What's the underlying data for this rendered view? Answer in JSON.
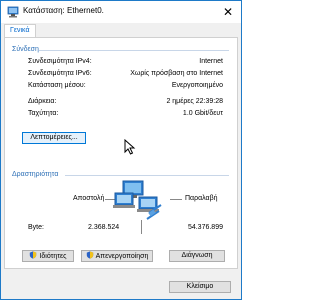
{
  "window": {
    "title": "Κατάσταση: Ethernet0.",
    "close_glyph": "✕"
  },
  "tabs": [
    {
      "label": "Γενικά"
    }
  ],
  "connection": {
    "heading": "Σύνδεση",
    "rows": [
      {
        "label": "Συνδεσιμότητα IPv4:",
        "value": "Internet"
      },
      {
        "label": "Συνδεσιμότητα IPv6:",
        "value": "Χωρίς πρόσβαση στο Internet"
      },
      {
        "label": "Κατάσταση μέσου:",
        "value": "Ενεργοποιημένο"
      },
      {
        "label": "Διάρκεια:",
        "value": "2 ημέρες 22:39:28"
      },
      {
        "label": "Ταχύτητα:",
        "value": "1.0 Gbit/δευτ"
      }
    ],
    "details_button": "Λεπτομέρειες..."
  },
  "activity": {
    "heading": "Δραστηριότητα",
    "sent_label": "Αποστολή",
    "received_label": "Παραλαβή",
    "bytes_label": "Byte:",
    "sent_value": "2.368.524",
    "received_value": "54.376.899"
  },
  "buttons": {
    "properties": "Ιδιότητες",
    "disable": "Απενεργοποίηση",
    "diagnose": "Διάγνωση",
    "close": "Κλείσιμο"
  },
  "colors": {
    "accent": "#2c6fb6",
    "window_border": "#1e7ac8"
  }
}
